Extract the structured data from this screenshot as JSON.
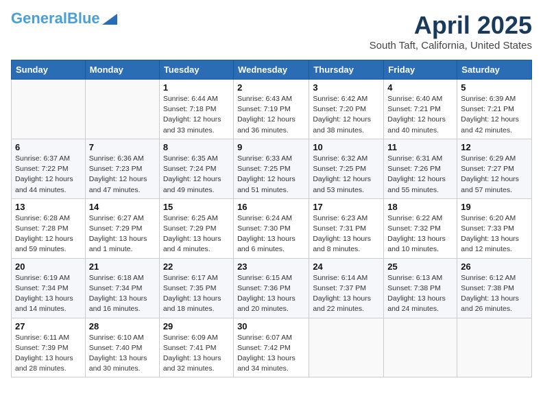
{
  "logo": {
    "general": "General",
    "blue": "Blue",
    "icon_title": "GeneralBlue logo"
  },
  "header": {
    "month": "April 2025",
    "location": "South Taft, California, United States"
  },
  "weekdays": [
    "Sunday",
    "Monday",
    "Tuesday",
    "Wednesday",
    "Thursday",
    "Friday",
    "Saturday"
  ],
  "weeks": [
    [
      {
        "day": "",
        "info": ""
      },
      {
        "day": "",
        "info": ""
      },
      {
        "day": "1",
        "info": "Sunrise: 6:44 AM\nSunset: 7:18 PM\nDaylight: 12 hours and 33 minutes."
      },
      {
        "day": "2",
        "info": "Sunrise: 6:43 AM\nSunset: 7:19 PM\nDaylight: 12 hours and 36 minutes."
      },
      {
        "day": "3",
        "info": "Sunrise: 6:42 AM\nSunset: 7:20 PM\nDaylight: 12 hours and 38 minutes."
      },
      {
        "day": "4",
        "info": "Sunrise: 6:40 AM\nSunset: 7:21 PM\nDaylight: 12 hours and 40 minutes."
      },
      {
        "day": "5",
        "info": "Sunrise: 6:39 AM\nSunset: 7:21 PM\nDaylight: 12 hours and 42 minutes."
      }
    ],
    [
      {
        "day": "6",
        "info": "Sunrise: 6:37 AM\nSunset: 7:22 PM\nDaylight: 12 hours and 44 minutes."
      },
      {
        "day": "7",
        "info": "Sunrise: 6:36 AM\nSunset: 7:23 PM\nDaylight: 12 hours and 47 minutes."
      },
      {
        "day": "8",
        "info": "Sunrise: 6:35 AM\nSunset: 7:24 PM\nDaylight: 12 hours and 49 minutes."
      },
      {
        "day": "9",
        "info": "Sunrise: 6:33 AM\nSunset: 7:25 PM\nDaylight: 12 hours and 51 minutes."
      },
      {
        "day": "10",
        "info": "Sunrise: 6:32 AM\nSunset: 7:25 PM\nDaylight: 12 hours and 53 minutes."
      },
      {
        "day": "11",
        "info": "Sunrise: 6:31 AM\nSunset: 7:26 PM\nDaylight: 12 hours and 55 minutes."
      },
      {
        "day": "12",
        "info": "Sunrise: 6:29 AM\nSunset: 7:27 PM\nDaylight: 12 hours and 57 minutes."
      }
    ],
    [
      {
        "day": "13",
        "info": "Sunrise: 6:28 AM\nSunset: 7:28 PM\nDaylight: 12 hours and 59 minutes."
      },
      {
        "day": "14",
        "info": "Sunrise: 6:27 AM\nSunset: 7:29 PM\nDaylight: 13 hours and 1 minute."
      },
      {
        "day": "15",
        "info": "Sunrise: 6:25 AM\nSunset: 7:29 PM\nDaylight: 13 hours and 4 minutes."
      },
      {
        "day": "16",
        "info": "Sunrise: 6:24 AM\nSunset: 7:30 PM\nDaylight: 13 hours and 6 minutes."
      },
      {
        "day": "17",
        "info": "Sunrise: 6:23 AM\nSunset: 7:31 PM\nDaylight: 13 hours and 8 minutes."
      },
      {
        "day": "18",
        "info": "Sunrise: 6:22 AM\nSunset: 7:32 PM\nDaylight: 13 hours and 10 minutes."
      },
      {
        "day": "19",
        "info": "Sunrise: 6:20 AM\nSunset: 7:33 PM\nDaylight: 13 hours and 12 minutes."
      }
    ],
    [
      {
        "day": "20",
        "info": "Sunrise: 6:19 AM\nSunset: 7:34 PM\nDaylight: 13 hours and 14 minutes."
      },
      {
        "day": "21",
        "info": "Sunrise: 6:18 AM\nSunset: 7:34 PM\nDaylight: 13 hours and 16 minutes."
      },
      {
        "day": "22",
        "info": "Sunrise: 6:17 AM\nSunset: 7:35 PM\nDaylight: 13 hours and 18 minutes."
      },
      {
        "day": "23",
        "info": "Sunrise: 6:15 AM\nSunset: 7:36 PM\nDaylight: 13 hours and 20 minutes."
      },
      {
        "day": "24",
        "info": "Sunrise: 6:14 AM\nSunset: 7:37 PM\nDaylight: 13 hours and 22 minutes."
      },
      {
        "day": "25",
        "info": "Sunrise: 6:13 AM\nSunset: 7:38 PM\nDaylight: 13 hours and 24 minutes."
      },
      {
        "day": "26",
        "info": "Sunrise: 6:12 AM\nSunset: 7:38 PM\nDaylight: 13 hours and 26 minutes."
      }
    ],
    [
      {
        "day": "27",
        "info": "Sunrise: 6:11 AM\nSunset: 7:39 PM\nDaylight: 13 hours and 28 minutes."
      },
      {
        "day": "28",
        "info": "Sunrise: 6:10 AM\nSunset: 7:40 PM\nDaylight: 13 hours and 30 minutes."
      },
      {
        "day": "29",
        "info": "Sunrise: 6:09 AM\nSunset: 7:41 PM\nDaylight: 13 hours and 32 minutes."
      },
      {
        "day": "30",
        "info": "Sunrise: 6:07 AM\nSunset: 7:42 PM\nDaylight: 13 hours and 34 minutes."
      },
      {
        "day": "",
        "info": ""
      },
      {
        "day": "",
        "info": ""
      },
      {
        "day": "",
        "info": ""
      }
    ]
  ]
}
